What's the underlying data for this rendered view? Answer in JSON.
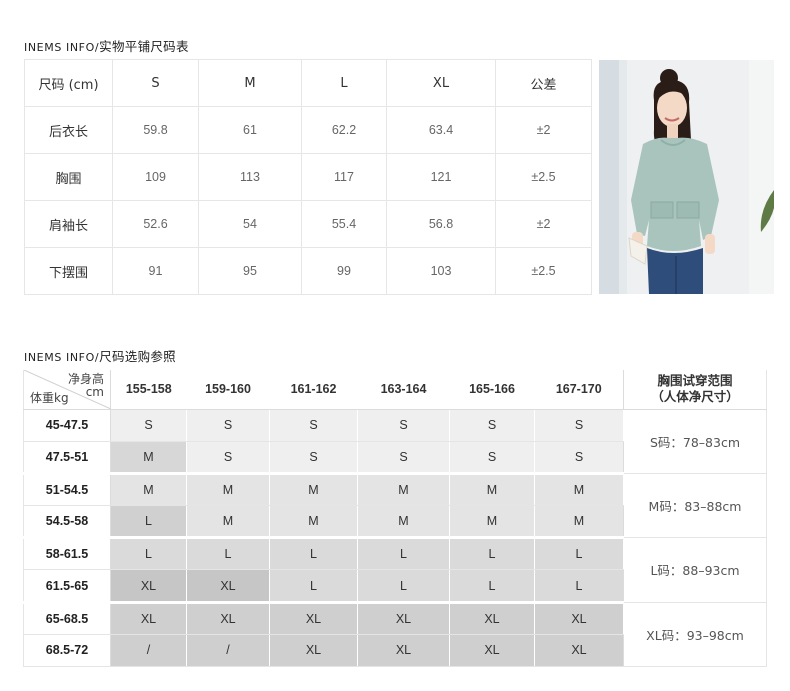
{
  "section1": {
    "title_en": "INEMS INFO/",
    "title_cn": "实物平铺尺码表",
    "header": [
      "尺码 (cm)",
      "S",
      "M",
      "L",
      "XL",
      "公差"
    ],
    "rows": [
      {
        "label": "后衣长",
        "values": [
          "59.8",
          "61",
          "62.2",
          "63.4"
        ],
        "tolerance": "±2"
      },
      {
        "label": "胸围",
        "values": [
          "109",
          "113",
          "117",
          "121"
        ],
        "tolerance": "±2.5"
      },
      {
        "label": "肩袖长",
        "values": [
          "52.6",
          "54",
          "55.4",
          "56.8"
        ],
        "tolerance": "±2"
      },
      {
        "label": "下摆围",
        "values": [
          "91",
          "95",
          "99",
          "103"
        ],
        "tolerance": "±2.5"
      }
    ]
  },
  "photo": {
    "icon": "model-photo",
    "colors": {
      "top": "#a8c4bd",
      "jeans": "#2e4d7a",
      "skin": "#f3d9c6",
      "hair": "#2a1d17"
    }
  },
  "section2": {
    "title_en": "INEMS INFO/",
    "title_cn": "尺码选购参照",
    "corner_top_line1": "净身高",
    "corner_top_line2": "cm",
    "corner_bottom": "体重kg",
    "heights": [
      "155-158",
      "159-160",
      "161-162",
      "163-164",
      "165-166",
      "167-170"
    ],
    "bust_header_line1": "胸围试穿范围",
    "bust_header_line2": "（人体净尺寸）",
    "rows": [
      {
        "weight": "45-47.5",
        "sizes": [
          "S",
          "S",
          "S",
          "S",
          "S",
          "S"
        ]
      },
      {
        "weight": "47.5-51",
        "sizes": [
          "M",
          "S",
          "S",
          "S",
          "S",
          "S"
        ]
      },
      {
        "weight": "51-54.5",
        "sizes": [
          "M",
          "M",
          "M",
          "M",
          "M",
          "M"
        ]
      },
      {
        "weight": "54.5-58",
        "sizes": [
          "L",
          "M",
          "M",
          "M",
          "M",
          "M"
        ]
      },
      {
        "weight": "58-61.5",
        "sizes": [
          "L",
          "L",
          "L",
          "L",
          "L",
          "L"
        ]
      },
      {
        "weight": "61.5-65",
        "sizes": [
          "XL",
          "XL",
          "L",
          "L",
          "L",
          "L"
        ]
      },
      {
        "weight": "65-68.5",
        "sizes": [
          "XL",
          "XL",
          "XL",
          "XL",
          "XL",
          "XL"
        ]
      },
      {
        "weight": "68.5-72",
        "sizes": [
          "/",
          "/",
          "XL",
          "XL",
          "XL",
          "XL"
        ]
      }
    ],
    "bust_ranges": [
      "S码：78–83cm",
      "M码：83–88cm",
      "L码：88–93cm",
      "XL码：93–98cm"
    ]
  }
}
